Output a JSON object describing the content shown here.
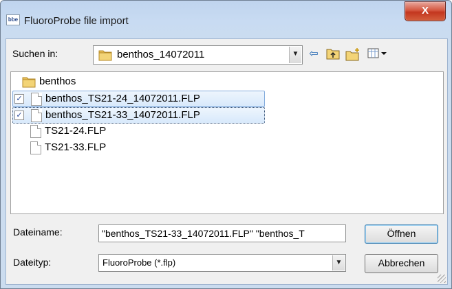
{
  "window": {
    "title": "FluoroProbe file import",
    "app_icon_text": "bbe",
    "close_label": "X"
  },
  "toolbar": {
    "look_in_label": "Suchen in:",
    "look_in_value": "benthos_14072011",
    "icons": [
      "back-arrow-icon",
      "up-folder-icon",
      "new-folder-icon",
      "view-menu-icon"
    ]
  },
  "files": [
    {
      "name": "benthos",
      "type": "folder",
      "checked": false
    },
    {
      "name": "benthos_TS21-24_14072011.FLP",
      "type": "file",
      "checked": true
    },
    {
      "name": "benthos_TS21-33_14072011.FLP",
      "type": "file",
      "checked": true
    },
    {
      "name": "TS21-24.FLP",
      "type": "file",
      "checked": false
    },
    {
      "name": "TS21-33.FLP",
      "type": "file",
      "checked": false
    }
  ],
  "filename": {
    "label": "Dateiname:",
    "value": "\"benthos_TS21-33_14072011.FLP\" \"benthos_T"
  },
  "filetype": {
    "label": "Dateityp:",
    "value": "FluoroProbe (*.flp)"
  },
  "buttons": {
    "open": "Öffnen",
    "cancel": "Abbrechen"
  },
  "colors": {
    "selection": "#d8e9fb",
    "selection_border": "#84acdd",
    "close_button": "#c7472f"
  }
}
